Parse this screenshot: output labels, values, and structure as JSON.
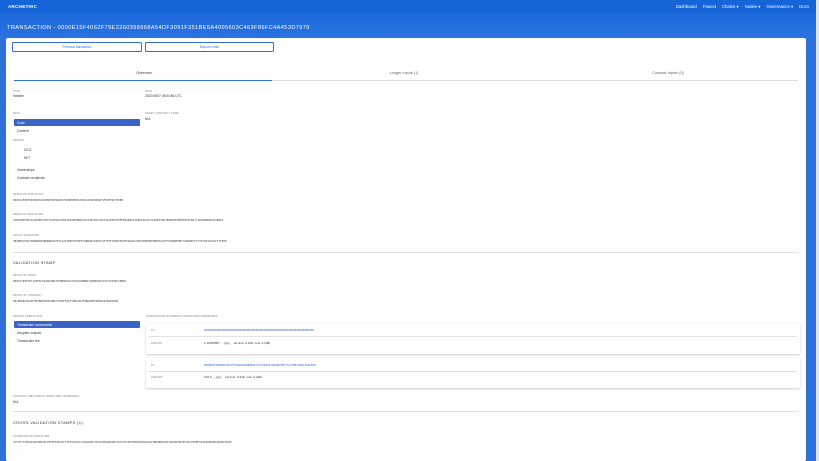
{
  "nav": {
    "brand": "ARCHETHIC",
    "links": [
      "Dashboard",
      "Faucet",
      "Chains ▾",
      "Nodes ▾",
      "Governance ▾",
      "Docs"
    ]
  },
  "title": "TRANSACTION - 0000E15F4062F79E2260398968A54DF3091F351BE5A4005603C463F86FC4A453D7979",
  "buttons": {
    "previous": "Previous transaction",
    "explore": "Explore chain"
  },
  "tabs": [
    "Overview",
    "Ledger Inputs (1)",
    "Contract Inputs (0)"
  ],
  "overview": {
    "type_label": "TYPE",
    "type_value": "transfer",
    "date_label": "DATE",
    "date_value": "2022/09/27 06:54:56 UTC",
    "data_label": "DATA",
    "smart_contract_code_label": "SMART CONTRACT CODE",
    "smart_contract_code_value": "N/A",
    "data_menu": [
      "Code",
      "Content"
    ],
    "ledger_label": "LEDGER",
    "ledger_menu": [
      "UCO",
      "NFT"
    ],
    "other_menu": [
      "Ownerships",
      "Contract recipients"
    ],
    "prev_pubkey_label": "PREVIOUS PUBLIC KEY",
    "prev_pubkey": "000151E9E7E4000032929B03955D6E47049B9EED43329A139608D9F4F003F6CF3EB0",
    "prev_sig_label": "PREVIOUS SIGNATURE",
    "prev_sig": "A3BF9B4FFB72A206B5CF0F76CD5ACD30D3D498F8B0D76233BCD5C18A79A1D9D7ED8FB36DBA43E88C2AC8C7A69E5F6D7880D9F2B68F85E7BA771B5988B9E9C0B0D2",
    "origin_sig_label": "ORIGIN SIGNATURE",
    "origin_sig": "3B2B9EC09A3FB6B8966B6B9BC87537A2A3DE0CDF8FFC8B8AB72881FAE7E3F309D6F66F9DA0AC99D0380E8D8EB5F6C6F79308DE0BC34B60B7CF73F7954223CFC3F5DE",
    "validation_stamp": "VALIDATION STAMP",
    "proof_work_label": "PROOF OF WORK",
    "proof_work": "000151E9E7E7192E5C9426D0DD7909B8D55A3CD56A0BB8C5AB9D8954C6C3693DCC0B8A",
    "proof_integrity_label": "PROOF OF INTEGRITY",
    "proof_integrity": "00C0DE8CB1A2F6E2BDE3E9FAB07C5E9FF6CF3D8CDA4F5B826B79EDDE2360D0500",
    "ledger_ops_label": "LEDGER OPERATIONS",
    "ledger_ops_menu": [
      "Transaction movements",
      "Unspent outputs",
      "Transaction fee"
    ],
    "tx_movements_label": "TRANSACTION MOVEMENTS (RESOLVED ADDRESSES)",
    "movements": [
      {
        "to_label": "TO",
        "to": "00000000000000000000000000000000000000000000000000000000000000000000",
        "amount_label": "AMOUNT",
        "amount": "1.16235867",
        "unit": "UCO",
        "rate": "(at time: 0.10$, now: 0.19$)"
      },
      {
        "to_label": "TO",
        "to": "0000E6F1E6E8033DCF9C5BA40A6B8D1FC1F72839672D4667DE77A37EE238013A4AF80",
        "amount_label": "AMOUNT",
        "amount": "100.0",
        "unit": "UCO",
        "rate": "(at time: 0.41$, now: 0.41$)"
      }
    ],
    "contract_recipients_label": "CONTRACT RECIPIENTS (RESOLVED ADDRESSES)",
    "contract_recipients_value": "N/A",
    "cross_stamps": "CROSS VALIDATION STAMPS (1)",
    "coord_sig_label": "COORDINATOR SIGNATURE",
    "coord_sig": "3CF4F7C2FB242844D026C29FE9F4EC0F71F69C943C7DA6A2BC7001F0E9D6D0E13D7547C0F09903E2D0A44A7BDD0B648A7D635E9DFEF45C95EBF5A34489D0DC8A8DC9590"
  }
}
